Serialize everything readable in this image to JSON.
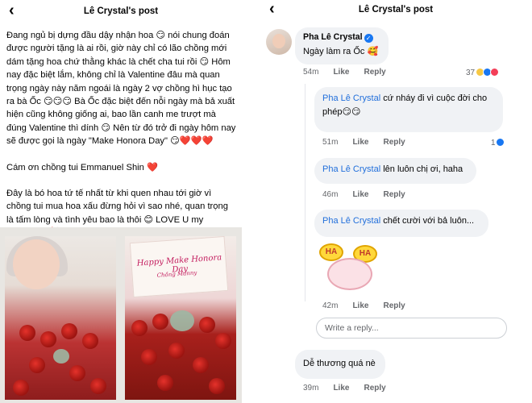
{
  "left_panel": {
    "title": "Lê Crystal's post",
    "back_icon": "chevron-left-icon",
    "paragraphs": [
      "Đang ngủ bị dựng đầu dậy nhận hoa 😏 nói chung đoán được người tặng là ai rồi, giờ này chỉ có lão chồng mới dám tặng hoa chứ thằng khác là chết cha tui rồi 😏 Hôm nay đặc biệt lắm, không chỉ là Valentine đâu mà quan trọng ngày này năm ngoái là ngày 2 vợ chồng hì hục tạo ra bà Ốc 😏😏😏 Bà Ốc đặc biệt đến nỗi ngày mà bả xuất hiện cũng không giống ai, bao lần canh me trượt mà đúng Valentine thì dính 😏 Nên từ đó trở đi ngày hôm nay sẽ được gọi là ngày \"Make Honora Day\" 😏❤️❤️❤️",
      "Cám ơn chồng tui Emmanuel Shin ❤️",
      "Đây là bó hoa tứ tế nhất từ khi quen nhau tới giờ vì chồng tui mua hoa xấu đừng hỏi vì sao nhé, quan trọng là tấm lòng và tình yêu bao là thôi 😊 LOVE U my CHỒNG 🥰🌹"
    ],
    "photo_card_text": "Happy Make Honora Day",
    "photo_card_sub": "Chồng Manny"
  },
  "right_panel": {
    "title": "Lê Crystal's post",
    "back_icon": "chevron-left-icon",
    "comments": [
      {
        "author": "Pha Lê Crystal",
        "text": "Ngày làm ra Ốc 🥰",
        "time": "54m",
        "like": "Like",
        "reply": "Reply",
        "reaction_count": "37"
      },
      {
        "mention": "Pha Lê Crystal",
        "text": " cứ nháy đi vì cuộc đời cho phép😏😏",
        "time": "51m",
        "like": "Like",
        "reply": "Reply",
        "reaction_count": "1"
      },
      {
        "mention": "Pha Lê Crystal",
        "text": " lên luôn chị ơi, haha",
        "time": "46m",
        "like": "Like",
        "reply": "Reply"
      },
      {
        "mention": "Pha Lê Crystal",
        "text": " chết cười với bả luôn...",
        "time": "42m",
        "like": "Like",
        "reply": "Reply",
        "sticker_text_left": "HA",
        "sticker_text_right": "HA"
      },
      {
        "text": "Dễ thương quá nè",
        "time": "39m",
        "like": "Like",
        "reply": "Reply"
      }
    ],
    "reply_placeholder": "Write a reply..."
  }
}
